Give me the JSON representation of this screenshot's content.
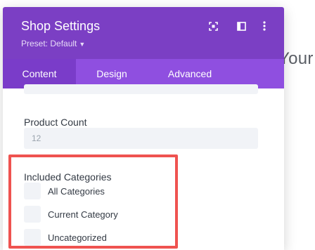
{
  "background": {
    "text": "Your"
  },
  "panel": {
    "title": "Shop Settings",
    "preset": "Preset: Default",
    "icons": [
      "expand-icon",
      "split-view-icon",
      "more-icon"
    ],
    "tabs": [
      {
        "label": "Content",
        "active": true
      },
      {
        "label": "Design",
        "active": false
      },
      {
        "label": "Advanced",
        "active": false
      }
    ]
  },
  "fields": {
    "product_count_label": "Product Count",
    "product_count_value": "12",
    "included_categories_label": "Included Categories",
    "categories": [
      {
        "label": "All Categories",
        "checked": false
      },
      {
        "label": "Current Category",
        "checked": false
      },
      {
        "label": "Uncategorized",
        "checked": false
      }
    ]
  },
  "colors": {
    "header": "#7b3fc4",
    "tabs": "#8f4fe0",
    "active_tab": "#7a3cc9",
    "highlight": "#ef5350"
  }
}
